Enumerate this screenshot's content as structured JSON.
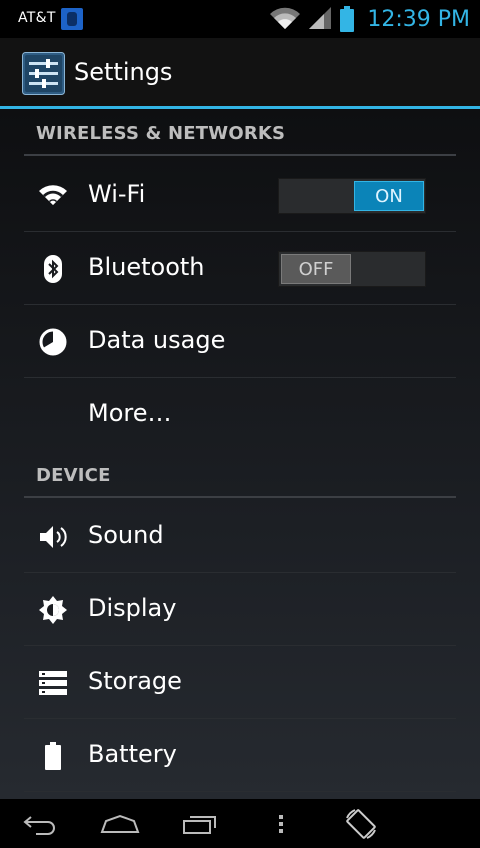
{
  "status_bar": {
    "carrier": "AT&T",
    "time": "12:39 PM",
    "icons": [
      "notification-app-icon",
      "wifi-signal-icon",
      "cell-signal-icon",
      "battery-icon"
    ]
  },
  "action_bar": {
    "title": "Settings",
    "icon": "settings-sliders-icon"
  },
  "sections": {
    "wireless": {
      "header": "WIRELESS & NETWORKS",
      "items": [
        {
          "label": "Wi-Fi",
          "icon": "wifi-icon",
          "toggle": "ON"
        },
        {
          "label": "Bluetooth",
          "icon": "bluetooth-icon",
          "toggle": "OFF"
        },
        {
          "label": "Data usage",
          "icon": "data-usage-icon"
        },
        {
          "label": "More…"
        }
      ]
    },
    "device": {
      "header": "DEVICE",
      "items": [
        {
          "label": "Sound",
          "icon": "speaker-icon"
        },
        {
          "label": "Display",
          "icon": "brightness-icon"
        },
        {
          "label": "Storage",
          "icon": "storage-icon"
        },
        {
          "label": "Battery",
          "icon": "battery-icon"
        }
      ]
    }
  },
  "nav_bar": {
    "buttons": [
      "back-icon",
      "home-icon",
      "recent-apps-icon",
      "menu-overflow-icon",
      "rotate-icon"
    ]
  },
  "colors": {
    "accent": "#33b5e5",
    "toggle_on": "#0b84b8",
    "toggle_off": "#5a5a5a"
  }
}
